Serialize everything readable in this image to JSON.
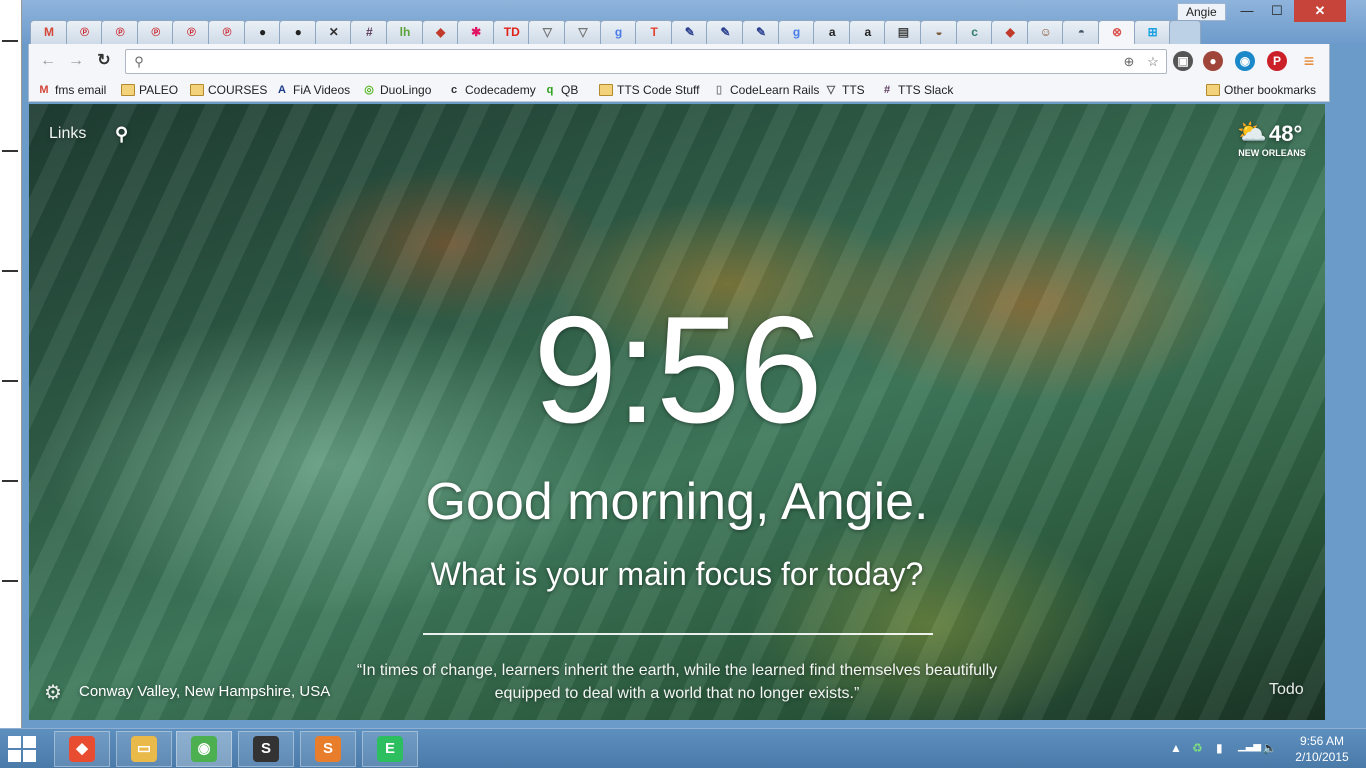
{
  "window": {
    "user_name": "Angie",
    "controls": {
      "minimize": "—",
      "maximize": "☐",
      "close": "✕"
    }
  },
  "tabs": [
    {
      "icon": "gmail-icon",
      "glyph": "M",
      "color": "#d44638"
    },
    {
      "icon": "pinterest-icon",
      "glyph": "℗",
      "color": "#cb2027"
    },
    {
      "icon": "pinterest-icon",
      "glyph": "℗",
      "color": "#cb2027"
    },
    {
      "icon": "pinterest-icon",
      "glyph": "℗",
      "color": "#cb2027"
    },
    {
      "icon": "pinterest-icon",
      "glyph": "℗",
      "color": "#cb2027"
    },
    {
      "icon": "pinterest-icon",
      "glyph": "℗",
      "color": "#cb2027"
    },
    {
      "icon": "github-icon",
      "glyph": "●",
      "color": "#222222"
    },
    {
      "icon": "github-icon",
      "glyph": "●",
      "color": "#222222"
    },
    {
      "icon": "tools-icon",
      "glyph": "✕",
      "color": "#333333"
    },
    {
      "icon": "slack-hash-icon",
      "glyph": "#",
      "color": "#5c3a5c"
    },
    {
      "icon": "lh-icon",
      "glyph": "lh",
      "color": "#5ca13a"
    },
    {
      "icon": "ruby-icon",
      "glyph": "◆",
      "color": "#c0392b"
    },
    {
      "icon": "slack-icon",
      "glyph": "✱",
      "color": "#e01563"
    },
    {
      "icon": "td-icon",
      "glyph": "TD",
      "color": "#e2231a"
    },
    {
      "icon": "triangle-icon",
      "glyph": "▽",
      "color": "#777777"
    },
    {
      "icon": "triangle-icon",
      "glyph": "▽",
      "color": "#777777"
    },
    {
      "icon": "google-icon",
      "glyph": "g",
      "color": "#4a7ee6"
    },
    {
      "icon": "todoist-icon",
      "glyph": "T",
      "color": "#e44332"
    },
    {
      "icon": "pen-icon",
      "glyph": "✎",
      "color": "#2a3f8f"
    },
    {
      "icon": "pen-icon",
      "glyph": "✎",
      "color": "#2a3f8f"
    },
    {
      "icon": "pen-icon",
      "glyph": "✎",
      "color": "#2a3f8f"
    },
    {
      "icon": "google-icon",
      "glyph": "g",
      "color": "#4a7ee6"
    },
    {
      "icon": "amazon-icon",
      "glyph": "a",
      "color": "#222222"
    },
    {
      "icon": "amazon-icon",
      "glyph": "a",
      "color": "#222222"
    },
    {
      "icon": "keyboard-icon",
      "glyph": "▤",
      "color": "#444444"
    },
    {
      "icon": "bowl-icon",
      "glyph": "◒",
      "color": "#7a5a3a"
    },
    {
      "icon": "codecademy-icon",
      "glyph": "c",
      "color": "#2e7d6a"
    },
    {
      "icon": "ruby-icon",
      "glyph": "◆",
      "color": "#c0392b"
    },
    {
      "icon": "avatar-icon",
      "glyph": "☺",
      "color": "#885533"
    },
    {
      "icon": "teapot-icon",
      "glyph": "◓",
      "color": "#445566"
    },
    {
      "icon": "momentum-icon",
      "glyph": "⊗",
      "color": "#d9534f",
      "active": true
    },
    {
      "icon": "windows-icon",
      "glyph": "⊞",
      "color": "#1ba1e2"
    }
  ],
  "toolbar": {
    "back": "←",
    "forward": "→",
    "reload": "↻",
    "url_value": "",
    "url_placeholder": "",
    "search_glyph": "⚲",
    "location_glyph": "⊕",
    "star_glyph": "☆",
    "menu_glyph": "≡"
  },
  "extensions": [
    {
      "name": "puzzle-extension-icon",
      "glyph": "▣",
      "color": "#555555"
    },
    {
      "name": "tomato-extension-icon",
      "glyph": "●",
      "color": "#a0453a"
    },
    {
      "name": "circle-extension-icon",
      "glyph": "◉",
      "color": "#1a88c9"
    },
    {
      "name": "pinterest-extension-icon",
      "glyph": "P",
      "color": "#cb2027"
    },
    {
      "name": "menu-icon",
      "glyph": "≡",
      "color": "#e67e22"
    }
  ],
  "bookmarks": [
    {
      "label": "fms email",
      "icon": "gmail-icon",
      "glyph": "M",
      "color": "#d44638"
    },
    {
      "label": "PALEO",
      "icon": "folder-icon"
    },
    {
      "label": "COURSES",
      "icon": "folder-icon"
    },
    {
      "label": "FiA Videos",
      "icon": "fia-icon",
      "glyph": "A",
      "color": "#1b3a8a"
    },
    {
      "label": "DuoLingo",
      "icon": "owl-icon",
      "glyph": "◎",
      "color": "#5cb82a"
    },
    {
      "label": "Codecademy",
      "icon": "codecademy-icon",
      "glyph": "c",
      "color": "#333333"
    },
    {
      "label": "QB",
      "icon": "qb-icon",
      "glyph": "q",
      "color": "#2ca01c"
    },
    {
      "label": "TTS Code Stuff",
      "icon": "folder-icon"
    },
    {
      "label": "CodeLearn Rails",
      "icon": "page-icon",
      "glyph": "▯",
      "color": "#888888"
    },
    {
      "label": "TTS",
      "icon": "triangle-icon",
      "glyph": "▽",
      "color": "#555555"
    },
    {
      "label": "TTS Slack",
      "icon": "slack-hash-icon",
      "glyph": "#",
      "color": "#5c3a5c"
    }
  ],
  "other_bookmarks": "Other bookmarks",
  "momentum": {
    "links": "Links",
    "search_glyph": "⚲",
    "weather_glyph": "⛅",
    "temperature": "48°",
    "city": "NEW ORLEANS",
    "time": "9:56",
    "greeting": "Good morning, Angie.",
    "focus_question": "What is your main focus for today?",
    "focus_value": "",
    "settings_glyph": "⚙",
    "photo_location": "Conway Valley, New Hampshire, USA",
    "quote": "“In times of change, learners inherit the earth, while the learned find themselves beautifully equipped to deal with a world that no longer exists.”",
    "todo": "Todo"
  },
  "taskbar": {
    "apps": [
      {
        "name": "git-app",
        "glyph": "◆",
        "color": "#e84d31"
      },
      {
        "name": "file-explorer-app",
        "glyph": "▭",
        "color": "#e9b949"
      },
      {
        "name": "chrome-app",
        "glyph": "◉",
        "color": "#4caf50",
        "active": true
      },
      {
        "name": "sublime-app",
        "glyph": "S",
        "color": "#333333"
      },
      {
        "name": "sublime-text-app",
        "glyph": "S",
        "color": "#e87e2b"
      },
      {
        "name": "evernote-app",
        "glyph": "E",
        "color": "#2dbe60"
      }
    ],
    "tray_glyphs": {
      "chevron": "▲",
      "recycle": "♻",
      "network": "▮",
      "signal": "▁▃▅",
      "volume": "🔈"
    },
    "time": "9:56 AM",
    "date": "2/10/2015"
  }
}
